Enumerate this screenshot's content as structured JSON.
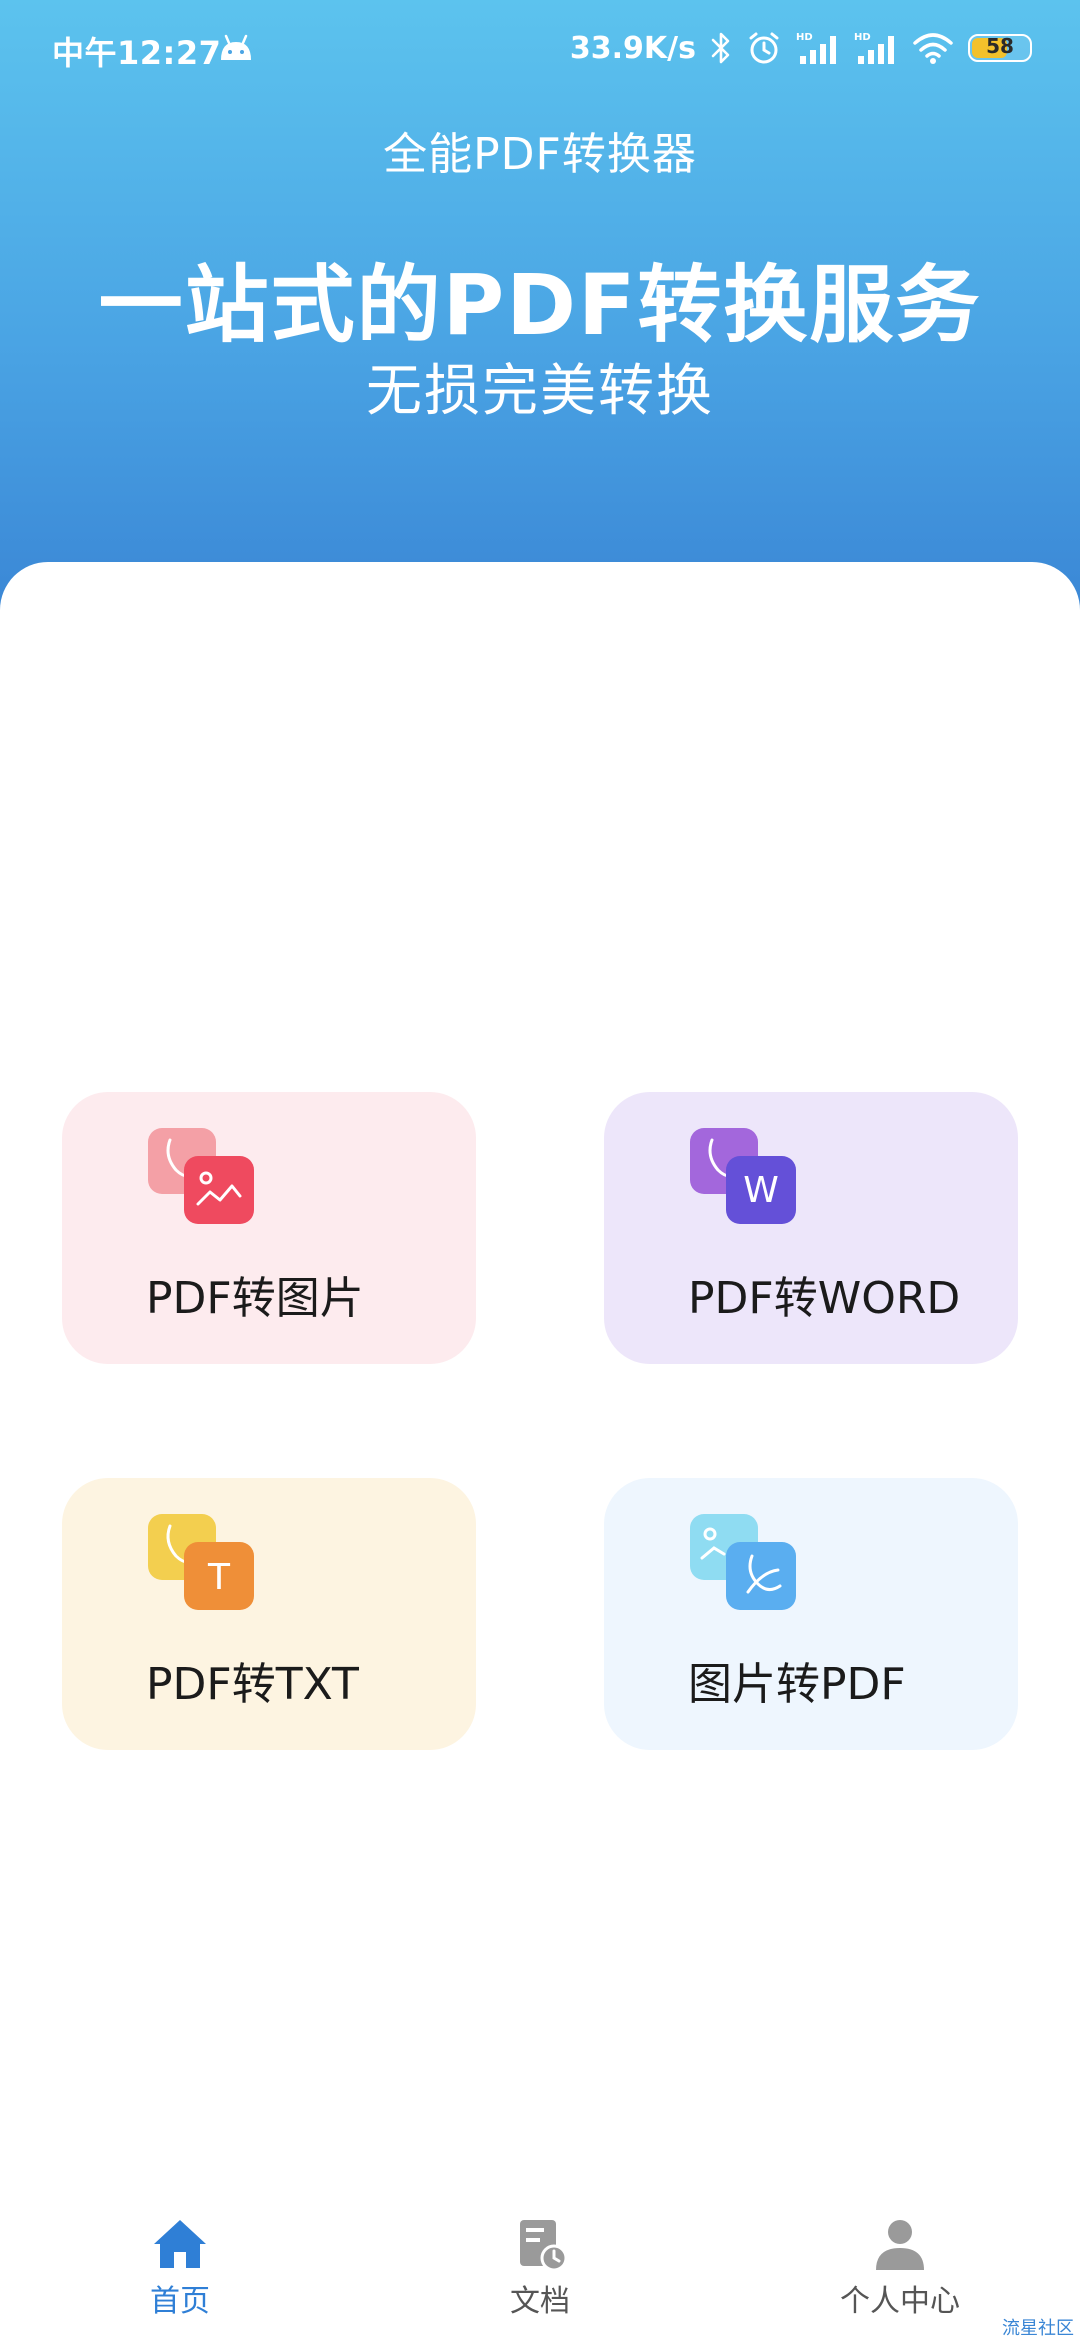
{
  "status_bar": {
    "time": "中午12:27",
    "net_speed": "33.9K/s",
    "battery": "58",
    "icons": [
      "android-icon",
      "bluetooth-icon",
      "alarm-icon",
      "hd-signal-icon",
      "hd-signal-icon",
      "wifi-icon",
      "battery-icon"
    ]
  },
  "header": {
    "app_title": "全能PDF转换器",
    "headline": "一站式的PDF转换服务",
    "subline": "无损完美转换"
  },
  "tools": [
    {
      "label": "PDF转图片",
      "icon": "pdf-to-image-icon",
      "bg": "#fdebee",
      "back": "#f4a0a6",
      "front": "#ef4a5f",
      "glyph": "image"
    },
    {
      "label": "PDF转WORD",
      "icon": "pdf-to-word-icon",
      "bg": "#ede6fa",
      "back": "#a367dc",
      "front": "#6450d8",
      "glyph": "W"
    },
    {
      "label": "PDF转TXT",
      "icon": "pdf-to-txt-icon",
      "bg": "#fdf4e1",
      "back": "#f3cf4f",
      "front": "#ef8f38",
      "glyph": "T"
    },
    {
      "label": "图片转PDF",
      "icon": "image-to-pdf-icon",
      "bg": "#eef6fe",
      "back": "#8fdcf2",
      "front": "#5aaef0",
      "glyph": "pdf"
    }
  ],
  "bottom_nav": {
    "items": [
      {
        "label": "首页",
        "icon": "home-icon",
        "active": true
      },
      {
        "label": "文档",
        "icon": "document-icon",
        "active": false
      },
      {
        "label": "个人中心",
        "icon": "profile-icon",
        "active": false
      }
    ]
  },
  "colors": {
    "header_gradient_top": "#5cc3ee",
    "header_gradient_bottom": "#3a86d5",
    "nav_active": "#2f7fd6",
    "nav_inactive": "#9a9a9a"
  },
  "watermark": "流星社区"
}
